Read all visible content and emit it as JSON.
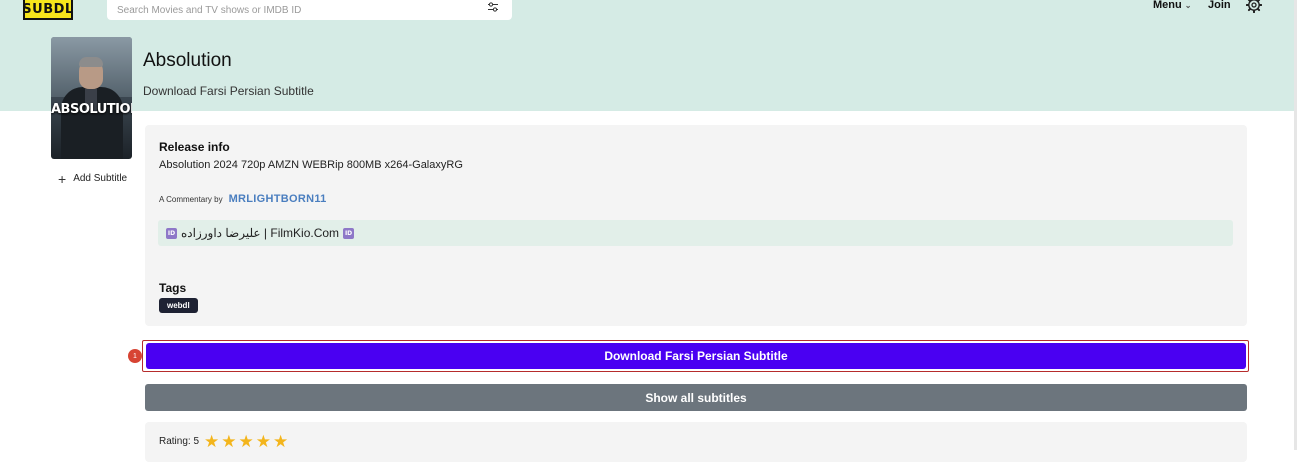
{
  "header": {
    "logo_text": "SUBDL",
    "search_placeholder": "Search Movies and TV shows or IMDB ID",
    "menu_label": "Menu",
    "join_label": "Join",
    "band_color": "#d5ebe5"
  },
  "movie": {
    "title": "Absolution",
    "subtitle": "Download Farsi Persian Subtitle",
    "poster_text": "ABSOLUTION"
  },
  "sidebar": {
    "add_subtitle_label": "Add Subtitle"
  },
  "release": {
    "label": "Release info",
    "name": "Absolution 2024 720p AMZN WEBRip 800MB x264-GalaxyRG",
    "commentary_prefix": "A Commentary by",
    "author": "MRLIGHTBORN11",
    "comment_text": "علیرضا داورزاده | FilmKio.Com",
    "tags_label": "Tags",
    "tags": [
      "webdl"
    ]
  },
  "actions": {
    "download_label": "Download Farsi Persian Subtitle",
    "download_color": "#4a00f2",
    "show_all_label": "Show all subtitles",
    "badge_number": "1"
  },
  "rating": {
    "label": "Rating: 5",
    "value": 5,
    "max": 5,
    "star_color": "#f3b51c"
  }
}
